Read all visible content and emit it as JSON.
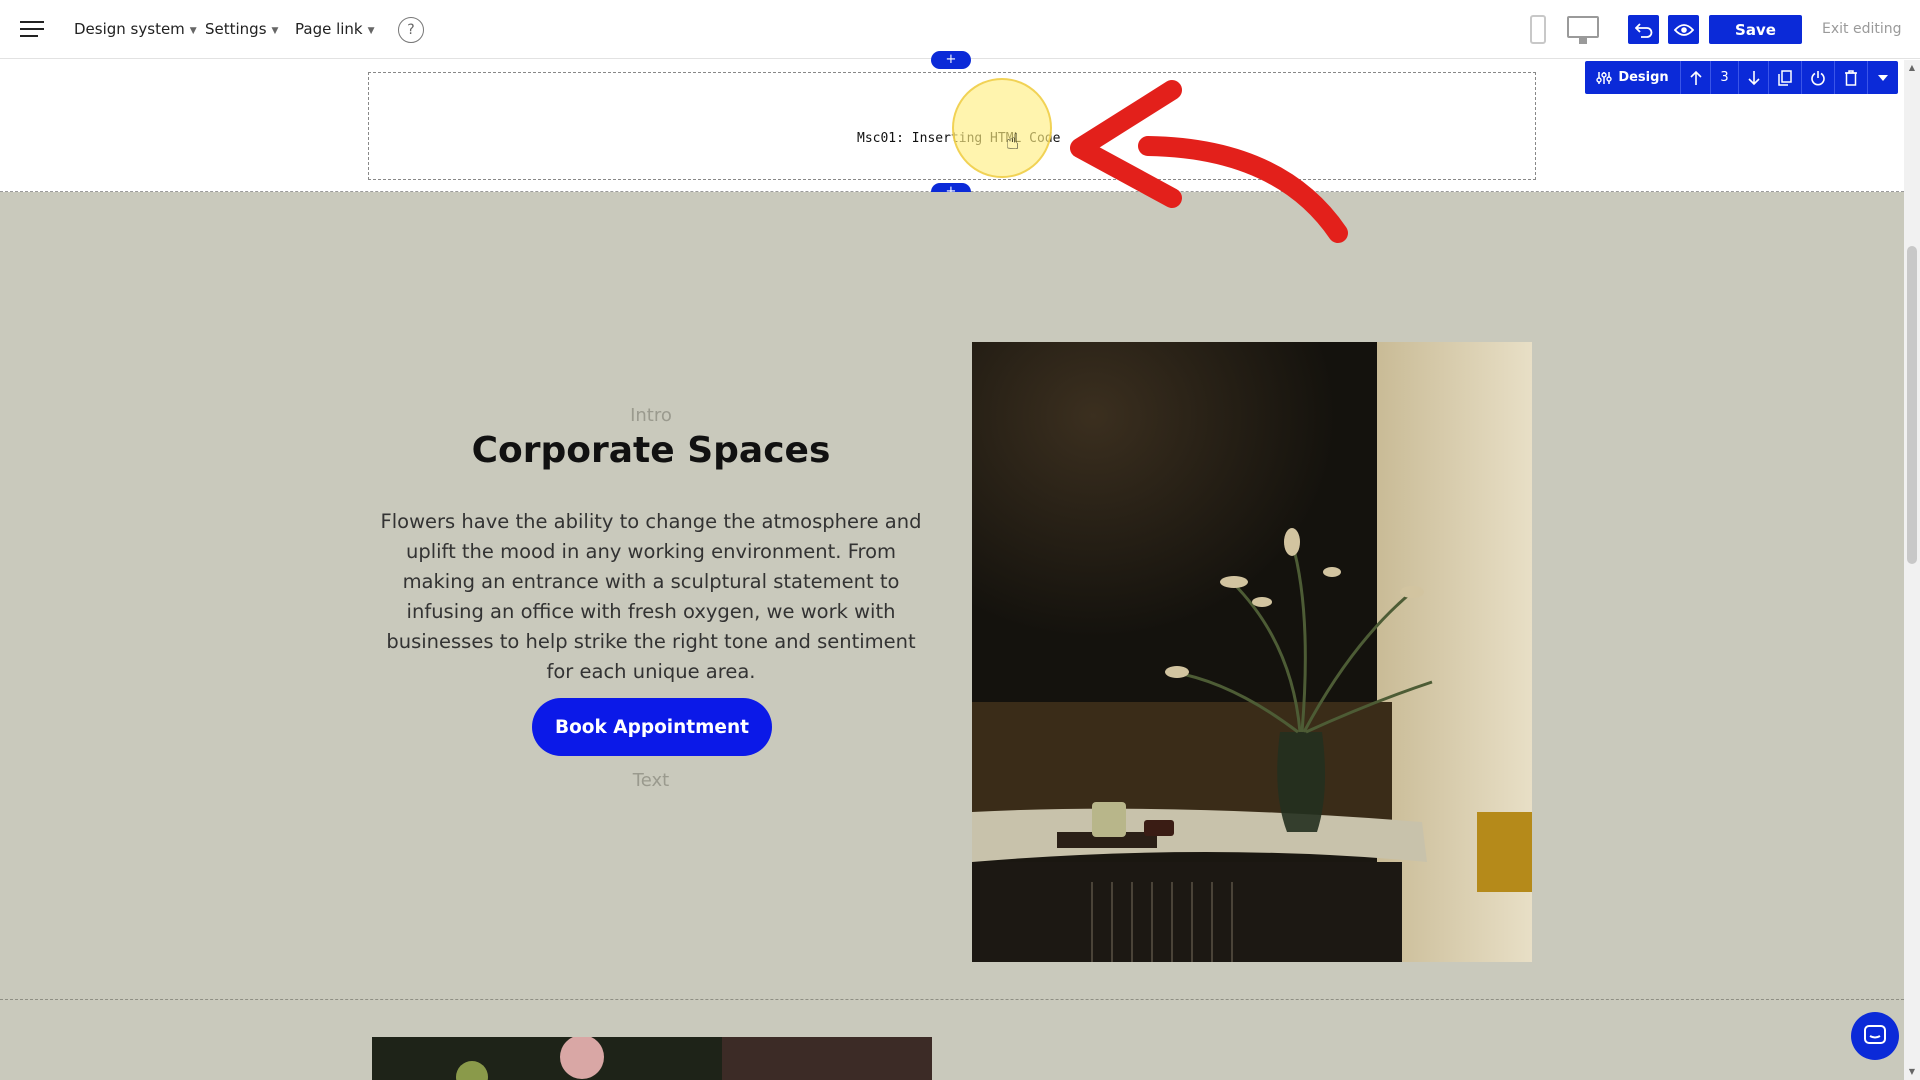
{
  "topbar": {
    "menu_items": [
      "Design system",
      "Settings",
      "Page link"
    ],
    "help_symbol": "?",
    "save_label": "Save",
    "exit_label": "Exit editing"
  },
  "icons": {
    "menu": "hamburger-menu-icon",
    "help": "question-mark-icon",
    "phone": "mobile-device-icon",
    "desktop": "desktop-monitor-icon",
    "undo": "undo-arrow-icon",
    "preview": "eye-icon",
    "chat": "chat-bubble-icon"
  },
  "element_toolbar": {
    "design_label": "Design",
    "position_count": "3"
  },
  "html_block": {
    "label": "Msc01: Inserting HTML Code"
  },
  "add_handle_symbol": "+",
  "content": {
    "intro": "Intro",
    "title": "Corporate Spaces",
    "body": "Flowers have the ability to change the atmosphere and uplift the mood in any working environment. From making an entrance with a sculptural statement to infusing an office with fresh oxygen, we work with businesses to help strike the right tone and sentiment for each unique area.",
    "cta_label": "Book Appointment",
    "text_label": "Text"
  },
  "colors": {
    "accent": "#0b2ad8",
    "cta": "#0b19e8",
    "section_bg": "#c9c9bc",
    "annotation_arrow": "#e3201b",
    "highlight": "#ffee82"
  }
}
